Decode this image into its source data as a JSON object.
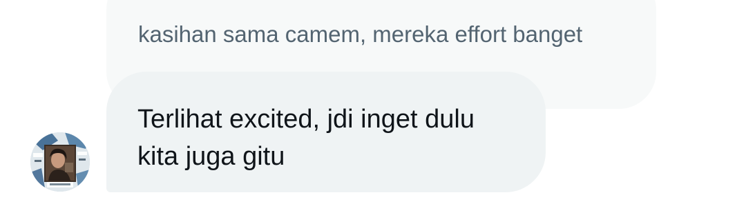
{
  "quoted_message": {
    "text": "kasihan sama camem, mereka effort banget"
  },
  "message": {
    "lines": [
      "Terlihat excited, jdi inget dulu",
      "kita juga gitu"
    ]
  },
  "avatar": {
    "icon": "user-avatar-photo"
  }
}
